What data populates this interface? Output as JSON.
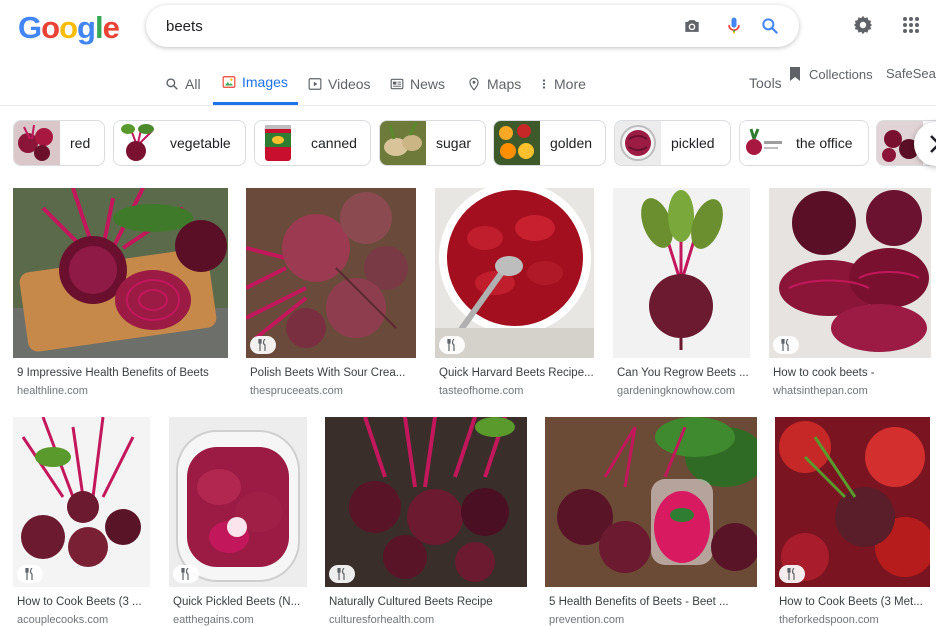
{
  "logo": {
    "letters": [
      "G",
      "o",
      "o",
      "g",
      "l",
      "e"
    ],
    "colors": [
      "#4285f4",
      "#ea4335",
      "#fbbc05",
      "#4285f4",
      "#34a853",
      "#ea4335"
    ]
  },
  "search": {
    "value": "beets"
  },
  "tabs": [
    {
      "label": "All",
      "icon": "search-icon"
    },
    {
      "label": "Images",
      "icon": "image-icon",
      "active": true
    },
    {
      "label": "Videos",
      "icon": "play-icon"
    },
    {
      "label": "News",
      "icon": "news-icon"
    },
    {
      "label": "Maps",
      "icon": "map-pin-icon"
    },
    {
      "label": "More",
      "icon": "more-vert-icon"
    }
  ],
  "tools_label": "Tools",
  "collections_label": "Collections",
  "safesearch_label": "SafeSearch",
  "chips": [
    "red",
    "vegetable",
    "canned",
    "sugar",
    "golden",
    "pickled",
    "the office"
  ],
  "results": [
    {
      "title": "9 Impressive Health Benefits of Beets",
      "source": "healthline.com"
    },
    {
      "title": "Polish Beets With Sour Crea...",
      "source": "thespruceeats.com"
    },
    {
      "title": "Quick Harvard Beets Recipe...",
      "source": "tasteofhome.com"
    },
    {
      "title": "Can You Regrow Beets ...",
      "source": "gardeningknowhow.com"
    },
    {
      "title": "How to cook beets -",
      "source": "whatsinthepan.com"
    },
    {
      "title": "How to Cook Beets (3 ...",
      "source": "acouplecooks.com"
    },
    {
      "title": "Quick Pickled Beets (N...",
      "source": "eatthegains.com"
    },
    {
      "title": "Naturally Cultured Beets Recipe",
      "source": "culturesforhealth.com"
    },
    {
      "title": "5 Health Benefits of Beets - Beet ...",
      "source": "prevention.com"
    },
    {
      "title": "How to Cook Beets (3 Met...",
      "source": "theforkedspoon.com"
    }
  ],
  "colors": {
    "accent": "#1a73e8",
    "beet": "#8b1538",
    "beet_dark": "#5a0f26",
    "leaf": "#4a8a2c",
    "stem": "#c2185b"
  }
}
